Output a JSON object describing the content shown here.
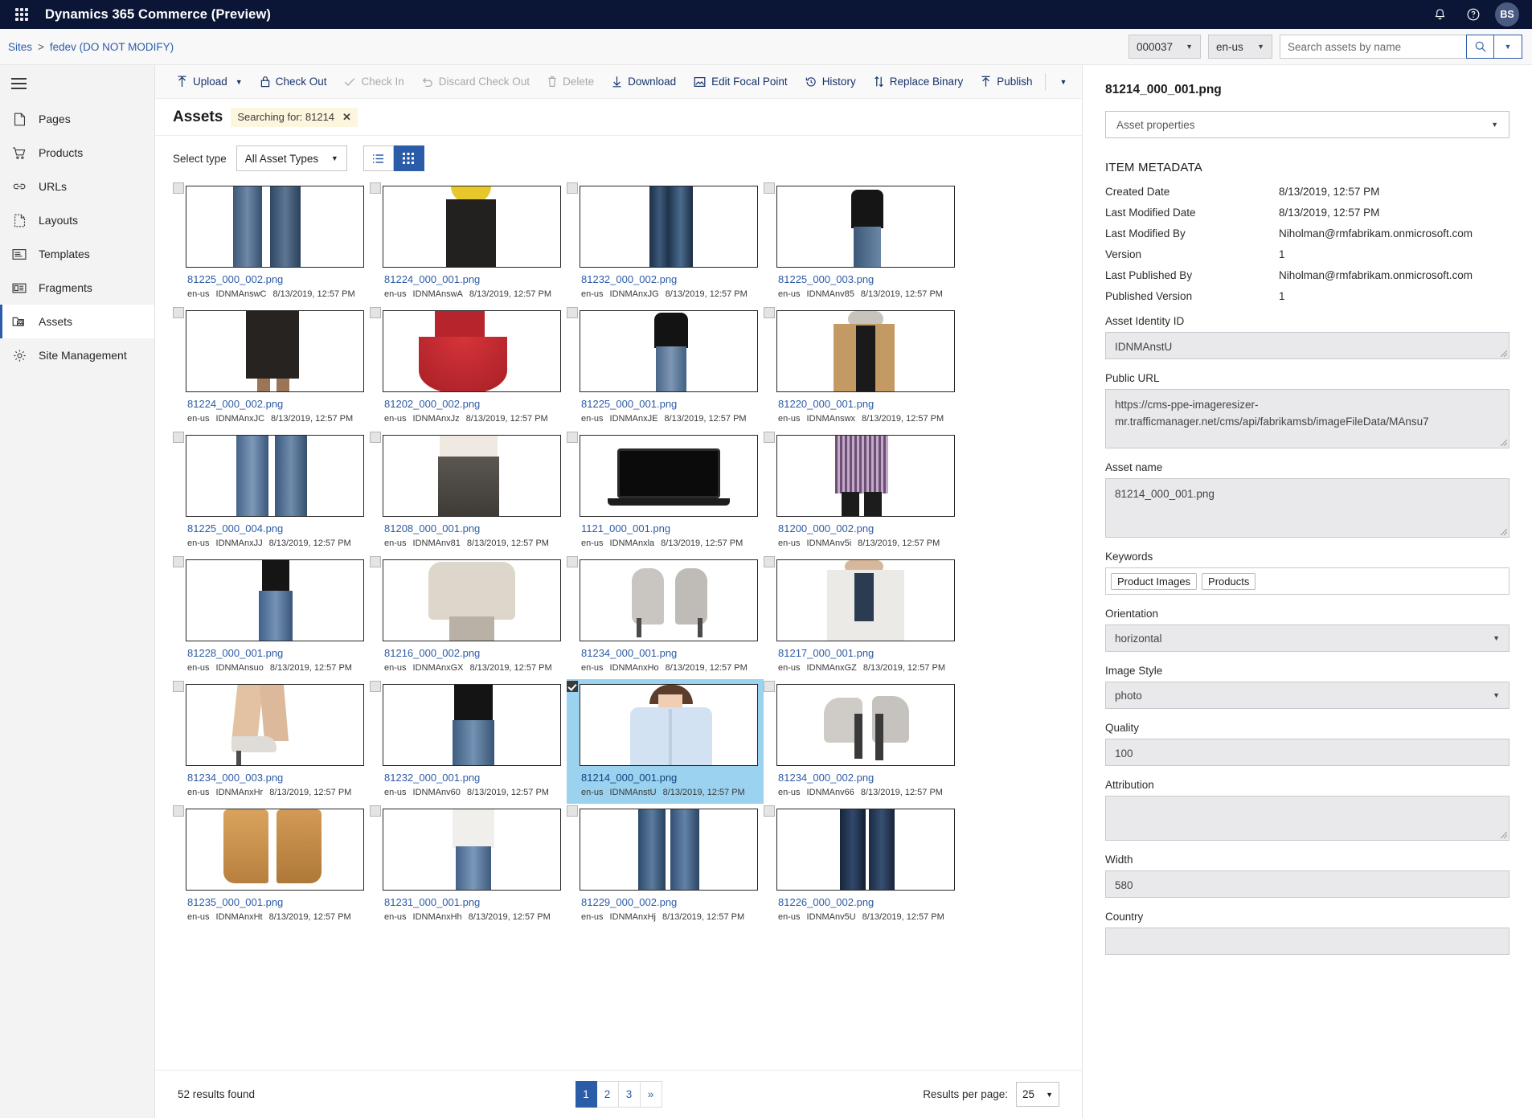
{
  "topbar": {
    "app_title": "Dynamics 365 Commerce (Preview)",
    "waffle_icon": "app-launcher-icon",
    "bell_icon": "notifications-icon",
    "help_icon": "help-icon",
    "avatar_initials": "BS"
  },
  "breadcrumb": {
    "root": "Sites",
    "separator": ">",
    "current": "fedev (DO NOT MODIFY)",
    "channel": "000037",
    "locale": "en-us",
    "search_placeholder": "Search assets by name",
    "search_value": "",
    "search_icon": "search-icon",
    "search_caret": "chevron-down-icon"
  },
  "sidebar": {
    "hamburger_icon": "hamburger-menu-icon",
    "items": [
      {
        "label": "Pages",
        "icon": "page-icon",
        "active": false
      },
      {
        "label": "Products",
        "icon": "shopping-cart-icon",
        "active": false
      },
      {
        "label": "URLs",
        "icon": "link-icon",
        "active": false
      },
      {
        "label": "Layouts",
        "icon": "layout-icon",
        "active": false
      },
      {
        "label": "Templates",
        "icon": "template-icon",
        "active": false
      },
      {
        "label": "Fragments",
        "icon": "fragment-icon",
        "active": false
      },
      {
        "label": "Assets",
        "icon": "assets-folder-icon",
        "active": true
      },
      {
        "label": "Site Management",
        "icon": "gear-icon",
        "active": false
      }
    ]
  },
  "toolbar": {
    "commands": [
      {
        "label": "Upload",
        "icon": "upload-arrow-icon",
        "disabled": false,
        "caret": true
      },
      {
        "label": "Check Out",
        "icon": "lock-icon",
        "disabled": false,
        "caret": false
      },
      {
        "label": "Check In",
        "icon": "checkmark-icon",
        "disabled": true,
        "caret": false
      },
      {
        "label": "Discard Check Out",
        "icon": "undo-icon",
        "disabled": true,
        "caret": false
      },
      {
        "label": "Delete",
        "icon": "trash-icon",
        "disabled": true,
        "caret": false
      },
      {
        "label": "Download",
        "icon": "download-arrow-icon",
        "disabled": false,
        "caret": false
      },
      {
        "label": "Edit Focal Point",
        "icon": "focal-point-icon",
        "disabled": false,
        "caret": false
      },
      {
        "label": "History",
        "icon": "history-clock-icon",
        "disabled": false,
        "caret": false
      },
      {
        "label": "Replace Binary",
        "icon": "swap-arrows-icon",
        "disabled": false,
        "caret": false
      },
      {
        "label": "Publish",
        "icon": "publish-arrow-icon",
        "disabled": false,
        "caret": false
      }
    ],
    "overflow_caret": "chevron-down-icon"
  },
  "assets_header": {
    "title": "Assets",
    "search_chip_label": "Searching for: 81214",
    "search_chip_clear": "✕"
  },
  "filters": {
    "select_type_label": "Select type",
    "asset_type_value": "All Asset Types",
    "list_view_icon": "list-view-icon",
    "grid_view_icon": "grid-view-icon",
    "active_view": "grid"
  },
  "grid": {
    "locale": "en-us",
    "date": "8/13/2019, 12:57 PM",
    "tiles": [
      {
        "name": "81225_000_002.png",
        "id": "IDNMAnswC",
        "selected": false,
        "art": "jeans-legs"
      },
      {
        "name": "81224_000_001.png",
        "id": "IDNMAnswA",
        "selected": false,
        "art": "yellow-hood-coat"
      },
      {
        "name": "81232_000_002.png",
        "id": "IDNMAnxJG",
        "selected": false,
        "art": "dark-jeans"
      },
      {
        "name": "81225_000_003.png",
        "id": "IDNMAnv85",
        "selected": false,
        "art": "black-top-jeans"
      },
      {
        "name": "81224_000_002.png",
        "id": "IDNMAnxJC",
        "selected": false,
        "art": "black-coat"
      },
      {
        "name": "81202_000_002.png",
        "id": "IDNMAnxJz",
        "selected": false,
        "art": "red-dress"
      },
      {
        "name": "81225_000_001.png",
        "id": "IDNMAnxJE",
        "selected": false,
        "art": "black-tee-jeans"
      },
      {
        "name": "81220_000_001.png",
        "id": "IDNMAnswx",
        "selected": false,
        "art": "tan-blazer"
      },
      {
        "name": "81225_000_004.png",
        "id": "IDNMAnxJJ",
        "selected": false,
        "art": "blue-jeans-pair"
      },
      {
        "name": "81208_000_001.png",
        "id": "IDNMAnv81",
        "selected": false,
        "art": "grey-skirt"
      },
      {
        "name": "1121_000_001.png",
        "id": "IDNMAnxla",
        "selected": false,
        "art": "laptop"
      },
      {
        "name": "81200_000_002.png",
        "id": "IDNMAnv5i",
        "selected": false,
        "art": "striped-dress"
      },
      {
        "name": "81228_000_001.png",
        "id": "IDNMAnsuo",
        "selected": false,
        "art": "black-tank-jeans"
      },
      {
        "name": "81216_000_002.png",
        "id": "IDNMAnxGX",
        "selected": false,
        "art": "cream-sweater"
      },
      {
        "name": "81234_000_001.png",
        "id": "IDNMAnxHo",
        "selected": false,
        "art": "grey-heels"
      },
      {
        "name": "81217_000_001.png",
        "id": "IDNMAnxGZ",
        "selected": false,
        "art": "white-cardigan"
      },
      {
        "name": "81234_000_003.png",
        "id": "IDNMAnxHr",
        "selected": false,
        "art": "heel-legs"
      },
      {
        "name": "81232_000_001.png",
        "id": "IDNMAnv60",
        "selected": false,
        "art": "black-top-denim"
      },
      {
        "name": "81214_000_001.png",
        "id": "IDNMAnstU",
        "selected": true,
        "art": "blue-shirt-woman"
      },
      {
        "name": "81234_000_002.png",
        "id": "IDNMAnv66",
        "selected": false,
        "art": "grey-heels-back"
      },
      {
        "name": "81235_000_001.png",
        "id": "IDNMAnxHt",
        "selected": false,
        "art": "cowboy-boots"
      },
      {
        "name": "81231_000_001.png",
        "id": "IDNMAnxHh",
        "selected": false,
        "art": "white-top-jeans"
      },
      {
        "name": "81229_000_002.png",
        "id": "IDNMAnxHj",
        "selected": false,
        "art": "flare-jeans"
      },
      {
        "name": "81226_000_002.png",
        "id": "IDNMAnv5U",
        "selected": false,
        "art": "dark-denim"
      }
    ]
  },
  "pagination": {
    "results_found": "52 results found",
    "pages": [
      "1",
      "2",
      "3",
      "»"
    ],
    "active_page": "1",
    "results_per_page_label": "Results per page:",
    "results_per_page_value": "25"
  },
  "properties": {
    "title": "81214_000_001.png",
    "view_select": "Asset properties",
    "section_label": "ITEM METADATA",
    "metadata": [
      {
        "key": "Created Date",
        "value": "8/13/2019, 12:57 PM"
      },
      {
        "key": "Last Modified Date",
        "value": "8/13/2019, 12:57 PM"
      },
      {
        "key": "Last Modified By",
        "value": "Niholman@rmfabrikam.onmicrosoft.com"
      },
      {
        "key": "Version",
        "value": "1"
      },
      {
        "key": "Last Published By",
        "value": "Niholman@rmfabrikam.onmicrosoft.com"
      },
      {
        "key": "Published Version",
        "value": "1"
      }
    ],
    "asset_identity_id_label": "Asset Identity ID",
    "asset_identity_id_value": "IDNMAnstU",
    "public_url_label": "Public URL",
    "public_url_value": "https://cms-ppe-imageresizer-mr.trafficmanager.net/cms/api/fabrikamsb/imageFileData/MAnsu7",
    "asset_name_label": "Asset name",
    "asset_name_value": "81214_000_001.png",
    "keywords_label": "Keywords",
    "keywords": [
      "Product Images",
      "Products"
    ],
    "orientation_label": "Orientation",
    "orientation_value": "horizontal",
    "image_style_label": "Image Style",
    "image_style_value": "photo",
    "quality_label": "Quality",
    "quality_value": "100",
    "attribution_label": "Attribution",
    "attribution_value": "",
    "width_label": "Width",
    "width_value": "580",
    "country_label": "Country",
    "country_value": ""
  },
  "colors": {
    "topbar_bg": "#0b1536",
    "accent": "#2a5ca8",
    "link": "#2d5ca6",
    "selected_tile": "#9ad2ef",
    "chip_bg": "#fcf6de"
  }
}
